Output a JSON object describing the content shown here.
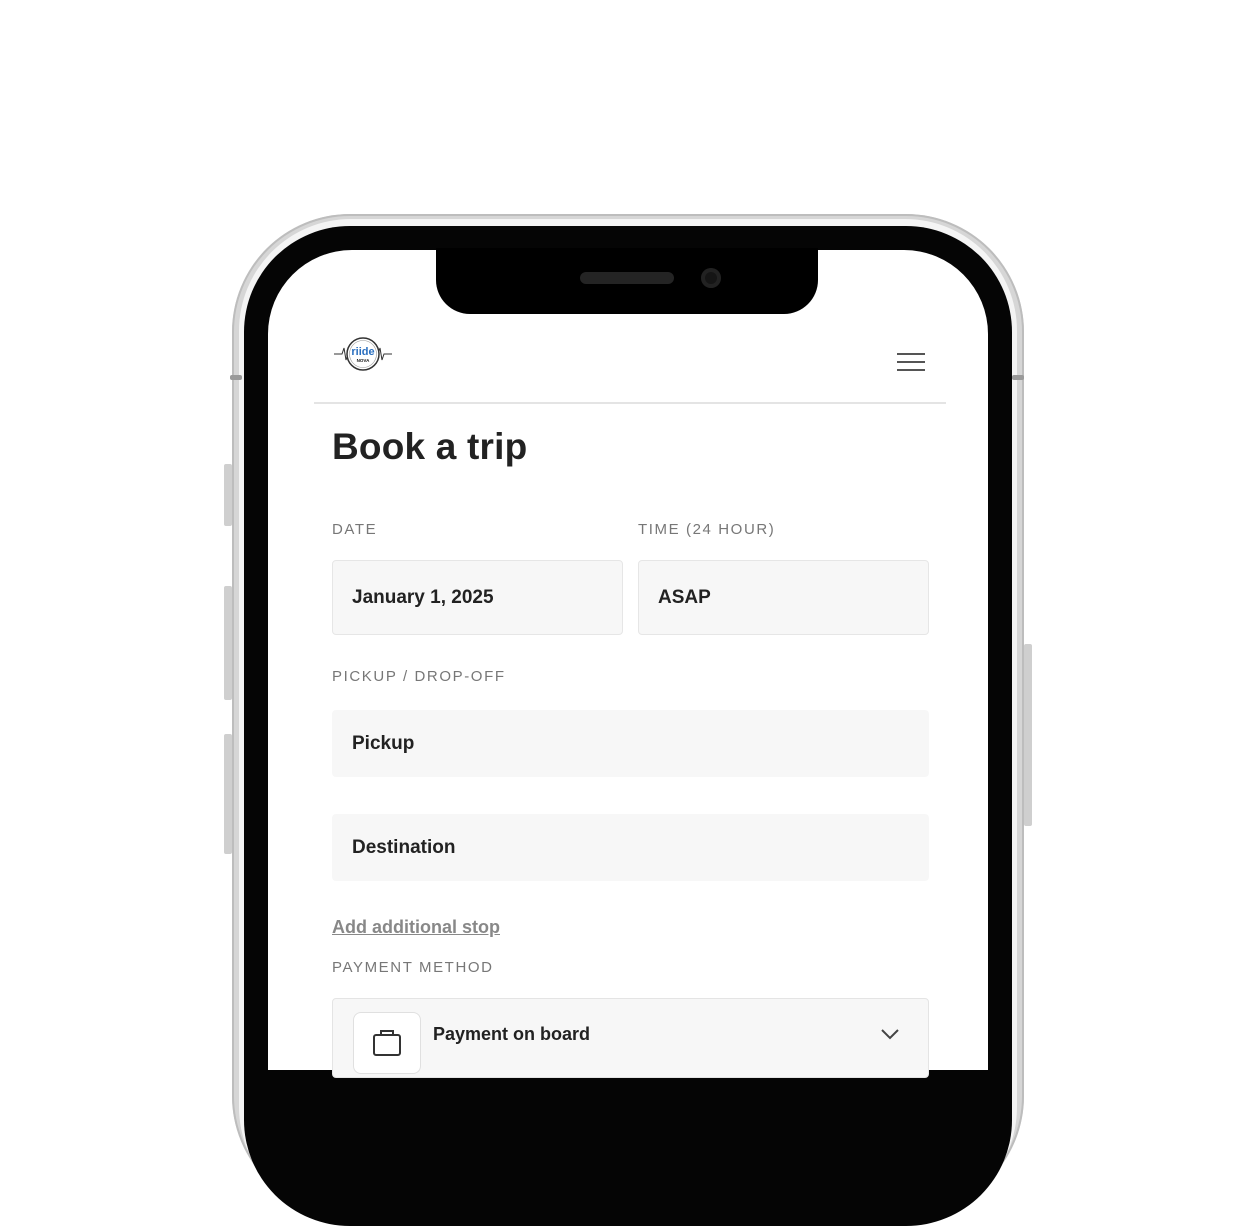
{
  "header": {
    "logo": {
      "text": "riide",
      "subtext": "NOVA"
    },
    "menu_icon": "hamburger-menu-icon"
  },
  "page": {
    "title": "Book a trip"
  },
  "form": {
    "date": {
      "label": "DATE",
      "value": "January 1, 2025"
    },
    "time": {
      "label": "TIME (24 HOUR)",
      "value": "ASAP"
    },
    "route": {
      "label": "PICKUP / DROP-OFF",
      "pickup_placeholder": "Pickup",
      "destination_placeholder": "Destination"
    },
    "add_stop_label": "Add additional stop",
    "payment": {
      "label": "PAYMENT METHOD",
      "selected": "Payment on board",
      "icon": "briefcase-icon"
    }
  },
  "colors": {
    "text": "#222222",
    "muted": "#777777",
    "field_bg": "#f7f7f7"
  }
}
